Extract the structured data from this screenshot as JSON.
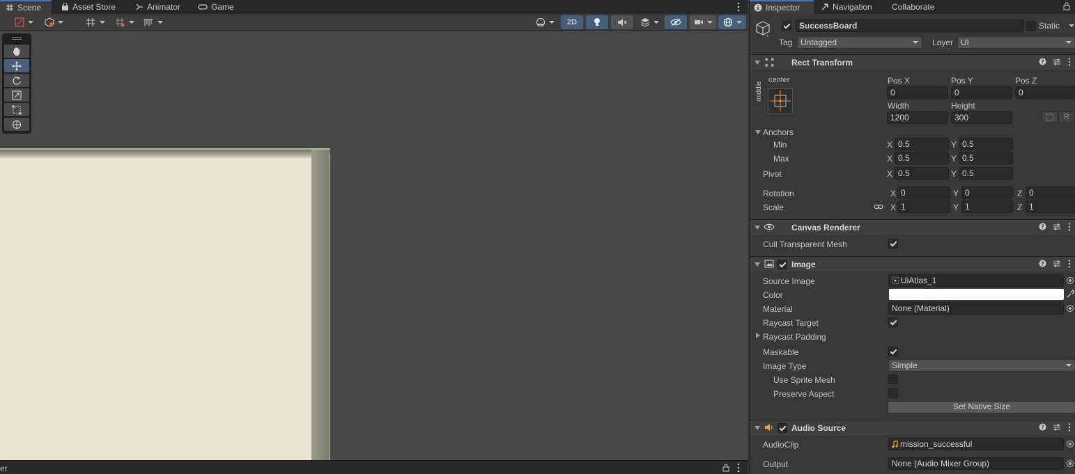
{
  "scene_tabs": [
    {
      "label": "Scene",
      "icon": "grid-icon"
    },
    {
      "label": "Asset Store",
      "icon": "bag-icon"
    },
    {
      "label": "Animator",
      "icon": "animator-icon"
    },
    {
      "label": "Game",
      "icon": "gamepad-icon"
    }
  ],
  "scene_toolbar": {
    "mode_2d_label": "2D"
  },
  "inspector_tabs": [
    {
      "label": "Inspector",
      "icon": "info-icon"
    },
    {
      "label": "Navigation",
      "icon": "navigation-icon"
    },
    {
      "label": "Collaborate"
    }
  ],
  "object": {
    "name": "SuccessBoard",
    "static_label": "Static",
    "tag_label": "Tag",
    "tag_value": "Untagged",
    "layer_label": "Layer",
    "layer_value": "UI"
  },
  "rect_transform": {
    "title": "Rect Transform",
    "anchor_preset_h": "center",
    "anchor_preset_v": "middle",
    "pos_x_label": "Pos X",
    "pos_x": "0",
    "pos_y_label": "Pos Y",
    "pos_y": "0",
    "pos_z_label": "Pos Z",
    "pos_z": "0",
    "width_label": "Width",
    "width": "1200",
    "height_label": "Height",
    "height": "300",
    "r_button": "R",
    "anchors_label": "Anchors",
    "min_label": "Min",
    "min_x": "0.5",
    "min_y": "0.5",
    "max_label": "Max",
    "max_x": "0.5",
    "max_y": "0.5",
    "pivot_label": "Pivot",
    "pivot_x": "0.5",
    "pivot_y": "0.5",
    "rotation_label": "Rotation",
    "rot_x": "0",
    "rot_y": "0",
    "rot_z": "0",
    "scale_label": "Scale",
    "scale_x": "1",
    "scale_y": "1",
    "scale_z": "1",
    "x": "X",
    "y": "Y",
    "z": "Z"
  },
  "canvas_renderer": {
    "title": "Canvas Renderer",
    "cull_label": "Cull Transparent Mesh"
  },
  "image": {
    "title": "Image",
    "source_image_label": "Source Image",
    "source_image_value": "UiAtlas_1",
    "color_label": "Color",
    "color_value": "#ffffff",
    "material_label": "Material",
    "material_value": "None (Material)",
    "raycast_target_label": "Raycast Target",
    "raycast_padding_label": "Raycast Padding",
    "maskable_label": "Maskable",
    "image_type_label": "Image Type",
    "image_type_value": "Simple",
    "use_sprite_mesh_label": "Use Sprite Mesh",
    "preserve_aspect_label": "Preserve Aspect",
    "set_native_size_label": "Set Native Size"
  },
  "audio_source": {
    "title": "Audio Source",
    "audioclip_label": "AudioClip",
    "audioclip_value": "mission_successful",
    "output_label": "Output",
    "output_value": "None (Audio Mixer Group)"
  },
  "bottom_bar_text": "er",
  "colors": {
    "accent": "#3a79bb",
    "selected_tool": "#46607c",
    "board": "#ece4d2"
  }
}
